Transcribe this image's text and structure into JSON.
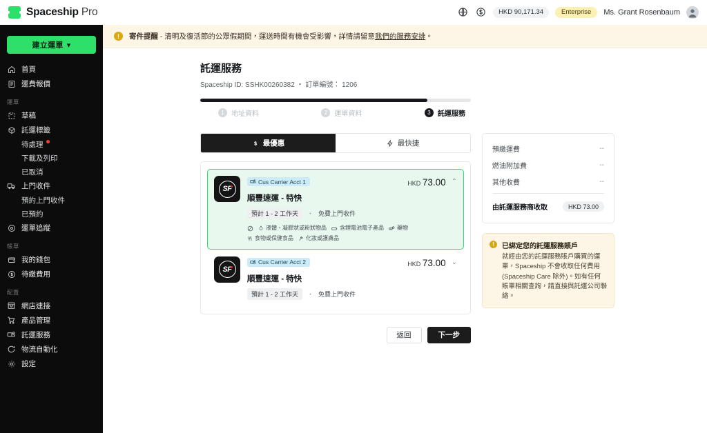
{
  "brand": {
    "name_bold": "Spaceship",
    "name_light": "Pro"
  },
  "header": {
    "globe_icon": "globe-icon",
    "currency_icon": "currency-dollar-icon",
    "balance": "HKD 90,171.34",
    "plan_badge": "Enterprise",
    "user_name": "Ms. Grant Rosenbaum",
    "avatar_icon": "user-avatar-icon"
  },
  "sidebar": {
    "create_button": "建立運單",
    "create_caret": "▾",
    "items": [
      {
        "label": "首頁",
        "icon": "home-icon",
        "type": "item"
      },
      {
        "label": "運費報價",
        "icon": "document-icon",
        "type": "item"
      },
      {
        "label": "運單",
        "type": "section"
      },
      {
        "label": "草稿",
        "icon": "draft-icon",
        "type": "item"
      },
      {
        "label": "託運標籤",
        "icon": "label-tag-icon",
        "type": "item"
      },
      {
        "label": "待處理",
        "type": "sub",
        "badge_dot": true
      },
      {
        "label": "下載及列印",
        "type": "sub"
      },
      {
        "label": "已取消",
        "type": "sub"
      },
      {
        "label": "上門收件",
        "icon": "truck-icon",
        "type": "item"
      },
      {
        "label": "預約上門收件",
        "type": "sub"
      },
      {
        "label": "已預約",
        "type": "sub"
      },
      {
        "label": "運單追蹤",
        "icon": "location-pin-icon",
        "type": "item"
      },
      {
        "label": "帳單",
        "type": "section"
      },
      {
        "label": "我的錢包",
        "icon": "wallet-icon",
        "type": "item"
      },
      {
        "label": "待繳費用",
        "icon": "coin-icon",
        "type": "item"
      },
      {
        "label": "配置",
        "type": "section"
      },
      {
        "label": "網店連接",
        "icon": "store-link-icon",
        "type": "item"
      },
      {
        "label": "產品管理",
        "icon": "cart-icon",
        "type": "item"
      },
      {
        "label": "託運服務",
        "icon": "shipping-service-icon",
        "type": "item"
      },
      {
        "label": "物流自動化",
        "icon": "automation-icon",
        "type": "item"
      },
      {
        "label": "設定",
        "icon": "gear-icon",
        "type": "item"
      }
    ]
  },
  "banner": {
    "icon": "warning-icon",
    "bold": "寄件提醒",
    "text": " - 清明及復活節的公眾假期間，運送時間有機會受影響，詳情請留意",
    "link": "我們的服務安排",
    "tail": "。"
  },
  "page": {
    "title": "託運服務",
    "subtitle": "Spaceship ID: SSHK00260382 ・ 訂單編號： 1206",
    "progress_percent": 84,
    "steps": [
      {
        "num": "1",
        "label": "地址資料",
        "active": false
      },
      {
        "num": "2",
        "label": "運單資料",
        "active": false
      },
      {
        "num": "3",
        "label": "託運服務",
        "active": true
      }
    ]
  },
  "tabs": [
    {
      "label": "最優惠",
      "icon": "dollar-icon",
      "active": true
    },
    {
      "label": "最快捷",
      "icon": "lightning-icon",
      "active": false
    }
  ],
  "carriers": [
    {
      "logo": "sf-express-logo",
      "account_badge": "Cus Carrier Acct 1",
      "account_badge_icon": "carrier-account-icon",
      "name": "順豐速運 - 特快",
      "eta_chip": "預計 1 - 2 工作天",
      "separator": "・",
      "pickup": "免費上門收件",
      "currency": "HKD",
      "amount": "73.00",
      "chevron": "⌃",
      "selected": true,
      "restrictions_prefix_icon": "no-entry-icon",
      "restrictions": [
        {
          "icon": "droplet-icon",
          "label": "液體、凝膠狀或粉狀物品"
        },
        {
          "icon": "battery-icon",
          "label": "含鋰電池電子產品"
        },
        {
          "icon": "pills-icon",
          "label": "藥物"
        },
        {
          "icon": "food-icon",
          "label": "食物或保健食品"
        },
        {
          "icon": "cosmetics-icon",
          "label": "化妝或護膚品"
        }
      ]
    },
    {
      "logo": "sf-express-logo",
      "account_badge": "Cus Carrier Acct 2",
      "account_badge_icon": "carrier-account-icon",
      "name": "順豐速運 - 特快",
      "eta_chip": "預計 1 - 2 工作天",
      "separator": "・",
      "pickup": "免費上門收件",
      "currency": "HKD",
      "amount": "73.00",
      "chevron": "⌄",
      "selected": false,
      "restrictions": []
    }
  ],
  "footer": {
    "back_label": "返回",
    "next_label": "下一步"
  },
  "summary": {
    "rows": [
      {
        "label": "預繳運費",
        "value": "--"
      },
      {
        "label": "燃油附加費",
        "value": "--"
      },
      {
        "label": "其他收費",
        "value": "--"
      }
    ],
    "total_label": "由託運服務商收取",
    "total_value": "HKD 73.00",
    "info": {
      "icon": "warning-icon",
      "title": "已綁定您的託運服務賬戶",
      "body": "就經由您的託運服務賬戶購買的運單，Spaceship 不會收取任何費用 (Spaceship Care 除外)。如有任何賬單相關查詢，請直接與託運公司聯絡。"
    }
  },
  "colors": {
    "brand_green": "#2ee06a",
    "dark": "#15171a",
    "banner_bg": "#fdf6e7",
    "selected_bg": "#e8f8ef",
    "badge_yellow": "#fdf0b4",
    "badge_blue": "#cdeaf7",
    "alert_dot": "#f5452c"
  }
}
